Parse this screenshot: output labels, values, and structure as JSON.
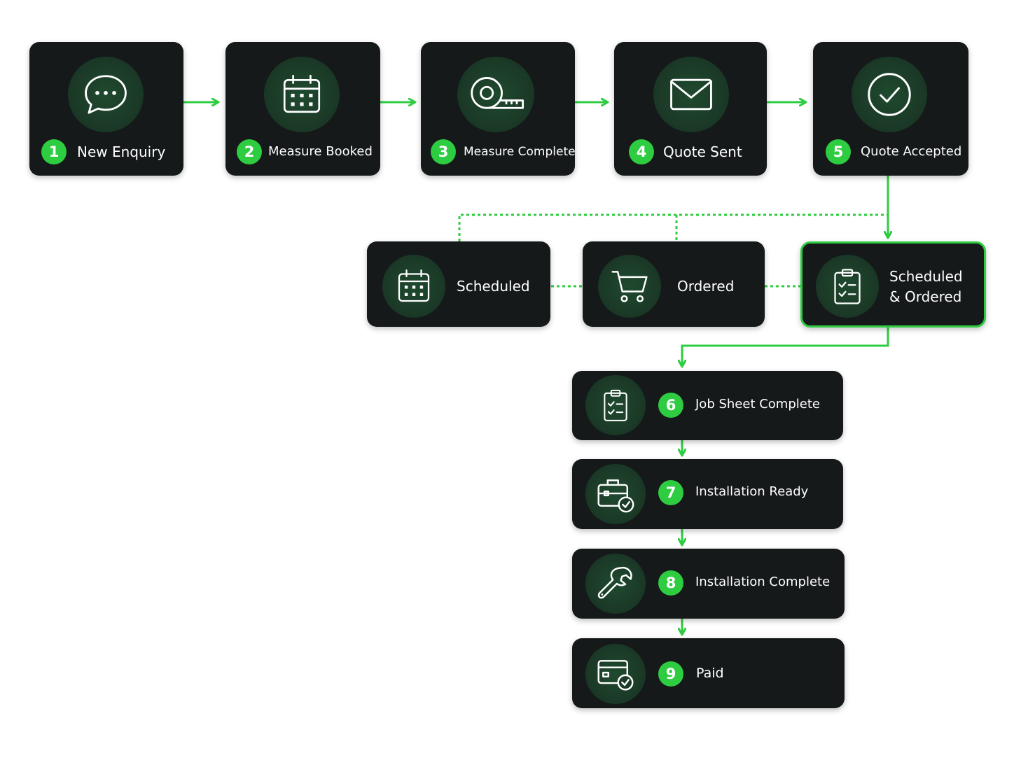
{
  "colors": {
    "accent": "#2ecc40",
    "card": "#15191a",
    "icon_bg": "#1b3a27"
  },
  "steps": [
    {
      "number": "1",
      "label": "New Enquiry",
      "icon": "chat-bubble-icon"
    },
    {
      "number": "2",
      "label": "Measure Booked",
      "icon": "calendar-icon"
    },
    {
      "number": "3",
      "label": "Measure Complete",
      "icon": "tape-measure-icon"
    },
    {
      "number": "4",
      "label": "Quote Sent",
      "icon": "envelope-icon"
    },
    {
      "number": "5",
      "label": "Quote Accepted",
      "icon": "check-circle-icon"
    },
    {
      "number": "6",
      "label": "Job Sheet Complete",
      "icon": "clipboard-checklist-icon"
    },
    {
      "number": "7",
      "label": "Installation Ready",
      "icon": "toolbox-check-icon"
    },
    {
      "number": "8",
      "label": "Installation Complete",
      "icon": "wrench-icon"
    },
    {
      "number": "9",
      "label": "Paid",
      "icon": "card-check-icon"
    }
  ],
  "branches": [
    {
      "label": "Scheduled",
      "icon": "calendar-icon"
    },
    {
      "label": "Ordered",
      "icon": "shopping-cart-icon"
    },
    {
      "label_line1": "Scheduled",
      "label_line2": "& Ordered",
      "icon": "clipboard-checklist-icon"
    }
  ]
}
